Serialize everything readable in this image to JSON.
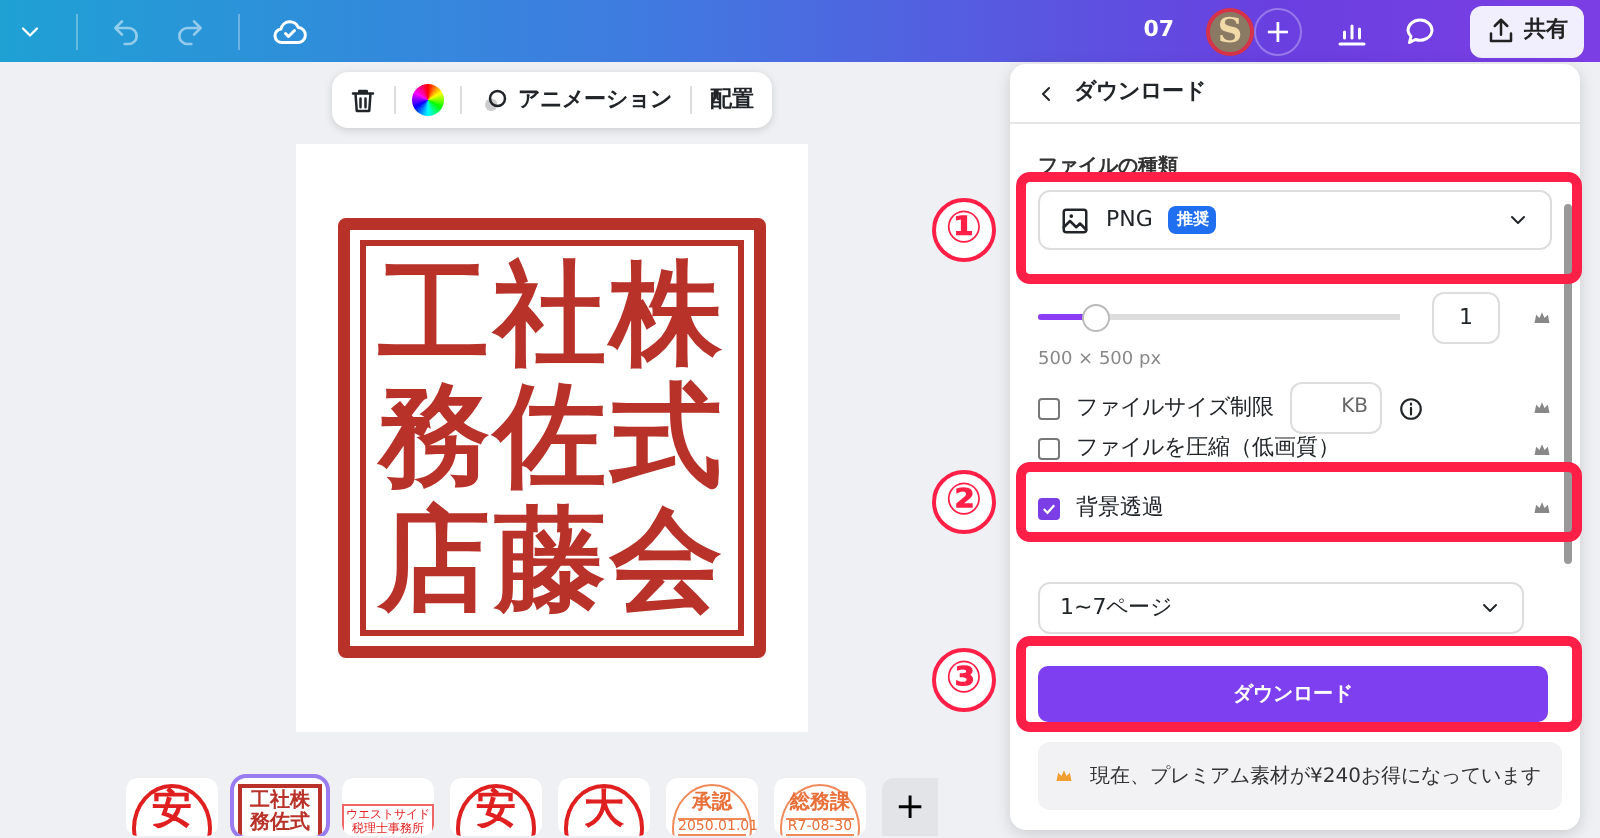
{
  "topbar": {
    "page_count": "07",
    "avatar_letter": "S",
    "share_label": "共有"
  },
  "toolbar": {
    "animation_label": "アニメーション",
    "arrange_label": "配置"
  },
  "stamp": {
    "rows": [
      "工社株",
      "務佐式",
      "店藤会"
    ]
  },
  "thumbnails": [
    {
      "lines": [
        "安"
      ],
      "kind": "circle",
      "selected": false
    },
    {
      "lines": [
        "工社株",
        "務佐式"
      ],
      "kind": "square",
      "selected": true
    },
    {
      "lines": [
        "ウエストサイド",
        "税理士事務所"
      ],
      "kind": "rect",
      "selected": false
    },
    {
      "lines": [
        "安"
      ],
      "kind": "circle",
      "selected": false
    },
    {
      "lines": [
        "大"
      ],
      "kind": "circle",
      "selected": false
    },
    {
      "lines": [
        "承認",
        "2050.01.01"
      ],
      "kind": "date",
      "selected": false
    },
    {
      "lines": [
        "総務課",
        "R7-08-30"
      ],
      "kind": "date",
      "selected": false
    }
  ],
  "add_page_label": "+",
  "panel": {
    "title": "ダウンロード",
    "file_type_label": "ファイルの種類",
    "file_type": "PNG",
    "file_type_badge": "推奨",
    "size": {
      "level": 0.16,
      "value": "1",
      "dimensions": "500 × 500 px"
    },
    "options": [
      {
        "label": "ファイルサイズ制限",
        "checked": false,
        "kind": "kb",
        "unit": "KB"
      },
      {
        "label": "ファイルを圧縮（低画質）",
        "checked": false,
        "kind": "plain"
      },
      {
        "label": "背景透過",
        "checked": true,
        "kind": "plain"
      }
    ],
    "pages": "1~7ページ",
    "download_label": "ダウンロード",
    "promo": "現在、プレミアム素材が¥240お得になっています"
  },
  "annotations": [
    {
      "number": "①"
    },
    {
      "number": "②"
    },
    {
      "number": "③"
    }
  ]
}
